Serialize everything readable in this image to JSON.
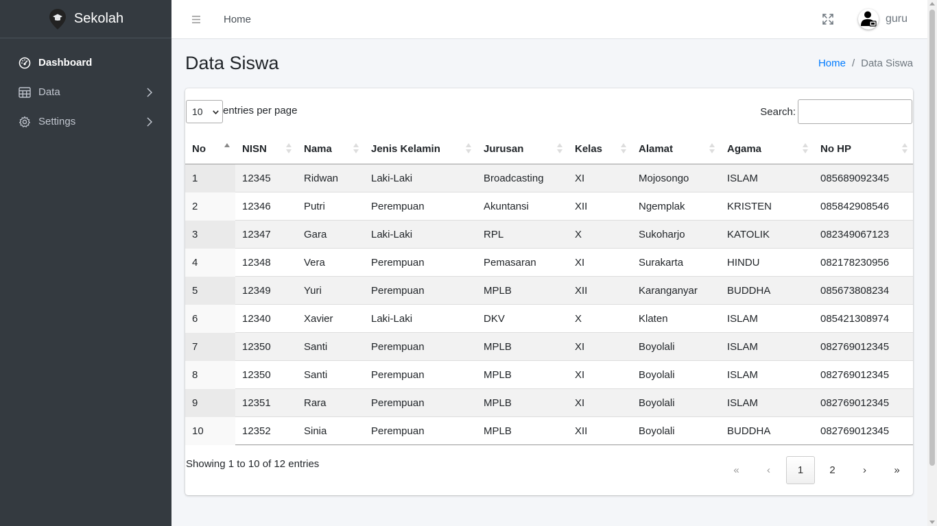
{
  "brand": {
    "name": "Sekolah"
  },
  "sidebar": {
    "items": [
      {
        "label": "Dashboard",
        "icon": "gauge-icon",
        "active": true
      },
      {
        "label": "Data",
        "icon": "table-icon"
      },
      {
        "label": "Settings",
        "icon": "gear-icon"
      }
    ]
  },
  "header": {
    "home_link": "Home",
    "user_name": "guru"
  },
  "page": {
    "title": "Data Siswa",
    "breadcrumb": {
      "home": "Home",
      "separator": "/",
      "current": "Data Siswa"
    }
  },
  "table_controls": {
    "entries_value": "10",
    "entries_label": "entries per page",
    "search_label": "Search:",
    "search_value": ""
  },
  "table": {
    "columns": [
      "No",
      "NISN",
      "Nama",
      "Jenis Kelamin",
      "Jurusan",
      "Kelas",
      "Alamat",
      "Agama",
      "No HP"
    ],
    "rows": [
      [
        "1",
        "12345",
        "Ridwan",
        "Laki-Laki",
        "Broadcasting",
        "XI",
        "Mojosongo",
        "ISLAM",
        "085689092345"
      ],
      [
        "2",
        "12346",
        "Putri",
        "Perempuan",
        "Akuntansi",
        "XII",
        "Ngemplak",
        "KRISTEN",
        "085842908546"
      ],
      [
        "3",
        "12347",
        "Gara",
        "Laki-Laki",
        "RPL",
        "X",
        "Sukoharjo",
        "KATOLIK",
        "082349067123"
      ],
      [
        "4",
        "12348",
        "Vera",
        "Perempuan",
        "Pemasaran",
        "XI",
        "Surakarta",
        "HINDU",
        "082178230956"
      ],
      [
        "5",
        "12349",
        "Yuri",
        "Perempuan",
        "MPLB",
        "XII",
        "Karanganyar",
        "BUDDHA",
        "085673808234"
      ],
      [
        "6",
        "12340",
        "Xavier",
        "Laki-Laki",
        "DKV",
        "X",
        "Klaten",
        "ISLAM",
        "085421308974"
      ],
      [
        "7",
        "12350",
        "Santi",
        "Perempuan",
        "MPLB",
        "XI",
        "Boyolali",
        "ISLAM",
        "082769012345"
      ],
      [
        "8",
        "12350",
        "Santi",
        "Perempuan",
        "MPLB",
        "XI",
        "Boyolali",
        "ISLAM",
        "082769012345"
      ],
      [
        "9",
        "12351",
        "Rara",
        "Perempuan",
        "MPLB",
        "XI",
        "Boyolali",
        "ISLAM",
        "082769012345"
      ],
      [
        "10",
        "12352",
        "Sinia",
        "Perempuan",
        "MPLB",
        "XII",
        "Boyolali",
        "BUDDHA",
        "082769012345"
      ]
    ]
  },
  "footer": {
    "info": "Showing 1 to 10 of 12 entries",
    "pagination": [
      {
        "label": "«",
        "name": "first-page-button",
        "disabled": true
      },
      {
        "label": "‹",
        "name": "prev-page-button",
        "disabled": true
      },
      {
        "label": "1",
        "name": "page-1-button",
        "current": true
      },
      {
        "label": "2",
        "name": "page-2-button"
      },
      {
        "label": "›",
        "name": "next-page-button"
      },
      {
        "label": "»",
        "name": "last-page-button"
      }
    ]
  },
  "colors": {
    "sidebar_bg": "#343a40",
    "sidebar_text": "#c2c7d0",
    "link": "#007bff",
    "content_bg": "#f4f6f9"
  }
}
